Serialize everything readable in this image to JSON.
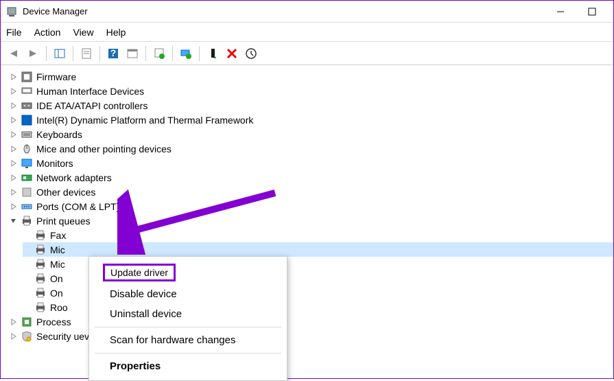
{
  "window": {
    "title": "Device Manager"
  },
  "menu": {
    "file": "File",
    "action": "Action",
    "view": "View",
    "help": "Help"
  },
  "tree": [
    {
      "icon": "firmware",
      "label": "Firmware",
      "expanded": false
    },
    {
      "icon": "hid",
      "label": "Human Interface Devices",
      "expanded": false
    },
    {
      "icon": "ide",
      "label": "IDE ATA/ATAPI controllers",
      "expanded": false
    },
    {
      "icon": "thermal",
      "label": "Intel(R) Dynamic Platform and Thermal Framework",
      "expanded": false
    },
    {
      "icon": "keyboard",
      "label": "Keyboards",
      "expanded": false
    },
    {
      "icon": "mouse",
      "label": "Mice and other pointing devices",
      "expanded": false
    },
    {
      "icon": "monitor",
      "label": "Monitors",
      "expanded": false
    },
    {
      "icon": "network",
      "label": "Network adapters",
      "expanded": false
    },
    {
      "icon": "other",
      "label": "Other devices",
      "expanded": false
    },
    {
      "icon": "port",
      "label": "Ports (COM & LPT)",
      "expanded": false
    },
    {
      "icon": "printer",
      "label": "Print queues",
      "expanded": true
    }
  ],
  "print_children": [
    {
      "label": "Fax",
      "selected": false
    },
    {
      "label": "Mic",
      "selected": true
    },
    {
      "label": "Mic",
      "selected": false
    },
    {
      "label": "On",
      "selected": false
    },
    {
      "label": "On",
      "selected": false
    },
    {
      "label": "Roo",
      "selected": false
    }
  ],
  "after_tree": [
    {
      "icon": "processor",
      "label": "Process",
      "expanded": false
    },
    {
      "icon": "security",
      "label": "Security uevices",
      "expanded": false
    }
  ],
  "ctx": {
    "update": "Update driver",
    "disable": "Disable device",
    "uninstall": "Uninstall device",
    "scan": "Scan for hardware changes",
    "properties": "Properties"
  },
  "accent": "#8200d1"
}
